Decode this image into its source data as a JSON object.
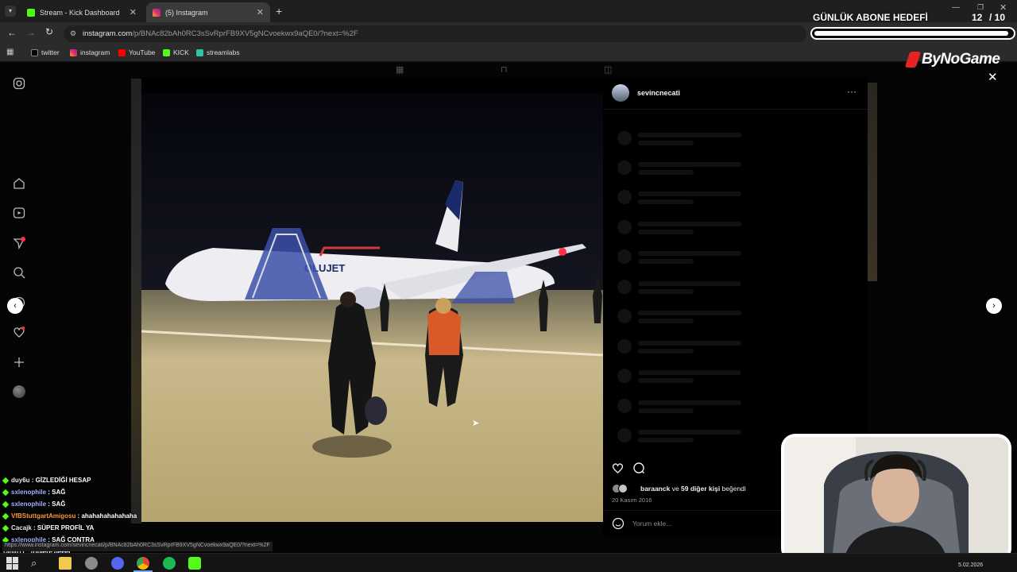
{
  "tabs": [
    {
      "title": "Stream - Kick Dashboard",
      "favicon": "kick-icon",
      "active": false
    },
    {
      "title": "(5) Instagram",
      "favicon": "instagram-icon",
      "active": true
    }
  ],
  "address": {
    "host": "instagram.com",
    "path": "/p/BNAc82bAh0RC3sSvRprFB9XV5gNCvoekwx9aQE0/?next=%2F"
  },
  "bookmarks": [
    {
      "label": "twitter",
      "icon": "x-icon"
    },
    {
      "label": "instagram",
      "icon": "instagram-icon"
    },
    {
      "label": "YouTube",
      "icon": "youtube-icon"
    },
    {
      "label": "KICK",
      "icon": "kick-icon"
    },
    {
      "label": "streamlabs",
      "icon": "streamlabs-icon"
    }
  ],
  "post": {
    "username": "sevincnecati",
    "likes_user": "baraanck",
    "likes_mid": " ve ",
    "likes_count": "59 diğer kişi",
    "likes_suffix": " beğendi",
    "date": "20 Kasım 2016",
    "comment_placeholder": "Yorum ekle...",
    "aircraft_livery": "OLUJET"
  },
  "status_url": "https://www.instagram.com/sevincnecati/p/BNAc82bAh0RC3sSvRprFB9XV5gNCvoekwx9aQE0/?next=%2F",
  "chat": [
    {
      "user": "duy6u",
      "user_color": "#e8e8e8",
      "message": "GİZLEDİĞİ HESAP"
    },
    {
      "user": "sxlenophile",
      "user_color": "#9fb4ff",
      "message": "SAĞ"
    },
    {
      "user": "sxlenophile",
      "user_color": "#9fb4ff",
      "message": "SAĞ"
    },
    {
      "user": "VfBStuttgartAmigosu",
      "user_color": "#ff9a3c",
      "message": "ahahahahahahaha"
    },
    {
      "user": "Cacajk",
      "user_color": "#e8e8e8",
      "message": "SÜPER PROFİL YA"
    },
    {
      "user": "sxlenophile",
      "user_color": "#9fb4ff",
      "message": "SAĞ CONTRA"
    },
    {
      "user": "radi011",
      "user_color": "#e8e8e8",
      "message": "triplere geeel"
    }
  ],
  "overlay": {
    "goal_title": "GÜNLÜK ABONE HEDEFİ",
    "goal_current": "12",
    "goal_total": "/ 10",
    "goal_progress": 1.0,
    "brand": "ByNoGame"
  },
  "taskbar": {
    "date": "5.02.2026"
  },
  "colors": {
    "accent_kick": "#53fc18",
    "instagram": "#e1306c",
    "panel_bg": "#000000",
    "page_bg": "#050505"
  }
}
